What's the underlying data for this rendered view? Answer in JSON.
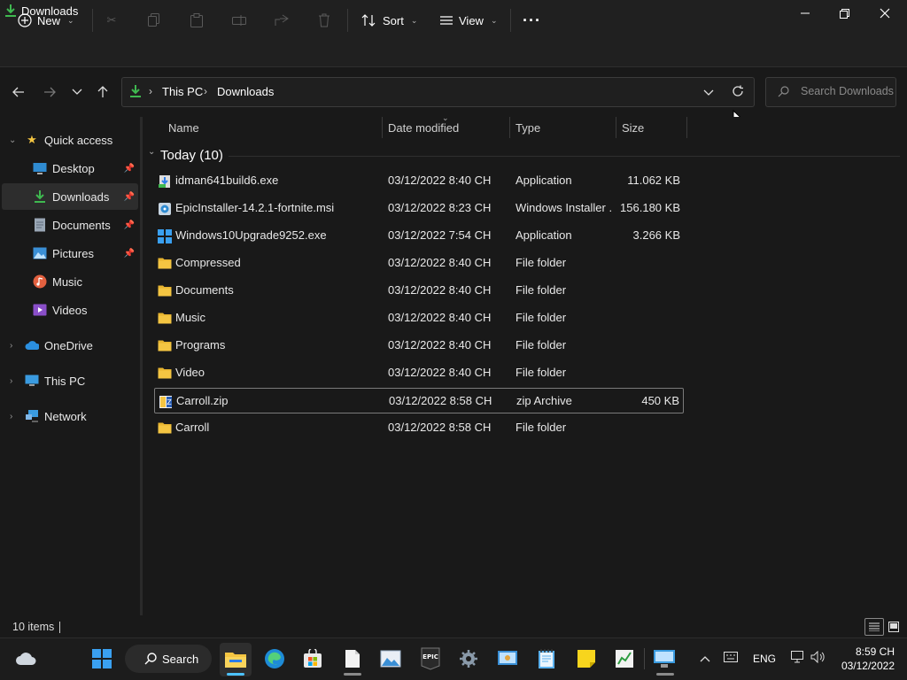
{
  "window": {
    "title": "Downloads"
  },
  "toolbar": {
    "new_label": "New",
    "sort_label": "Sort",
    "view_label": "View",
    "more_label": "···"
  },
  "address": {
    "segments": [
      "This PC",
      "Downloads"
    ]
  },
  "search": {
    "placeholder": "Search Downloads"
  },
  "sidebar": {
    "quick_access": "Quick access",
    "items": [
      {
        "label": "Desktop",
        "icon": "desktop-icon",
        "pinned": true
      },
      {
        "label": "Downloads",
        "icon": "download-icon",
        "pinned": true,
        "selected": true
      },
      {
        "label": "Documents",
        "icon": "document-icon",
        "pinned": true
      },
      {
        "label": "Pictures",
        "icon": "picture-icon",
        "pinned": true
      },
      {
        "label": "Music",
        "icon": "music-icon",
        "pinned": false
      },
      {
        "label": "Videos",
        "icon": "video-icon",
        "pinned": false
      }
    ],
    "onedrive": "OneDrive",
    "thispc": "This PC",
    "network": "Network"
  },
  "columns": {
    "name": "Name",
    "date": "Date modified",
    "type": "Type",
    "size": "Size"
  },
  "group": {
    "label": "Today (10)"
  },
  "files": [
    {
      "name": "idman641build6.exe",
      "date": "03/12/2022 8:40 CH",
      "type": "Application",
      "size": "11.062 KB",
      "icon": "idm-installer-icon"
    },
    {
      "name": "EpicInstaller-14.2.1-fortnite.msi",
      "date": "03/12/2022 8:23 CH",
      "type": "Windows Installer ...",
      "size": "156.180 KB",
      "icon": "msi-installer-icon"
    },
    {
      "name": "Windows10Upgrade9252.exe",
      "date": "03/12/2022 7:54 CH",
      "type": "Application",
      "size": "3.266 KB",
      "icon": "windows-logo-icon"
    },
    {
      "name": "Compressed",
      "date": "03/12/2022 8:40 CH",
      "type": "File folder",
      "size": "",
      "icon": "folder-icon"
    },
    {
      "name": "Documents",
      "date": "03/12/2022 8:40 CH",
      "type": "File folder",
      "size": "",
      "icon": "folder-icon"
    },
    {
      "name": "Music",
      "date": "03/12/2022 8:40 CH",
      "type": "File folder",
      "size": "",
      "icon": "folder-icon"
    },
    {
      "name": "Programs",
      "date": "03/12/2022 8:40 CH",
      "type": "File folder",
      "size": "",
      "icon": "folder-icon"
    },
    {
      "name": "Video",
      "date": "03/12/2022 8:40 CH",
      "type": "File folder",
      "size": "",
      "icon": "folder-icon"
    },
    {
      "name": "Carroll.zip",
      "date": "03/12/2022 8:58 CH",
      "type": "zip Archive",
      "size": "450 KB",
      "icon": "zip-archive-icon",
      "selected": true
    },
    {
      "name": "Carroll",
      "date": "03/12/2022 8:58 CH",
      "type": "File folder",
      "size": "",
      "icon": "folder-icon"
    }
  ],
  "status": {
    "count": "10 items"
  },
  "taskbar": {
    "search_label": "Search",
    "lang": "ENG",
    "time": "8:59 CH",
    "date": "03/12/2022"
  },
  "colors": {
    "folder": "#f4c542",
    "accent": "#4cc2ff",
    "download_green": "#3fb950"
  }
}
